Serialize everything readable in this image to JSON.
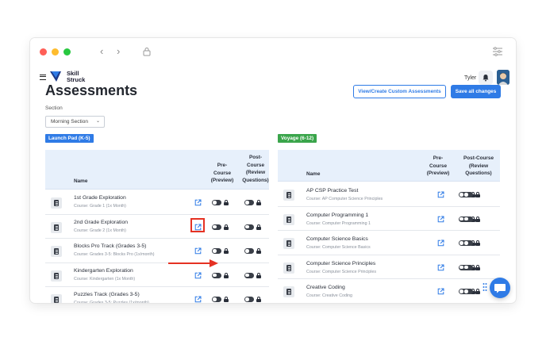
{
  "app": {
    "logo_text_line1": "Skill",
    "logo_text_line2": "Struck",
    "user_name": "Tyler"
  },
  "page": {
    "title": "Assessments",
    "view_create_button": "View/Create Custom Assessments",
    "save_all_button": "Save all changes",
    "section_label": "Section",
    "section_value": "Morning Section"
  },
  "columns": {
    "name": "Name",
    "pre_course_l1": "Pre-",
    "pre_course_l2": "Course",
    "pre_course_l3": "(Preview)",
    "left_post_l1": "Post-",
    "left_post_l2": "Course",
    "left_post_l3": "(Review",
    "left_post_l4": "Questions)",
    "right_post_l1": "Post-Course",
    "right_post_l2": "(Review",
    "right_post_l3": "Questions)"
  },
  "launch_pad": {
    "badge": "Launch Pad (K-5)",
    "rows": [
      {
        "title": "1st Grade Exploration",
        "course": "Course: Grade 1 (1x Month)"
      },
      {
        "title": "2nd Grade Exploration",
        "course": "Course: Grade 2 (1x Month)"
      },
      {
        "title": "Blocks Pro Track (Grades 3-5)",
        "course": "Course: Grades 3-5: Blocks Pro (1x/month)"
      },
      {
        "title": "Kindergarten Exploration",
        "course": "Course: Kindergarten (1x Month)"
      },
      {
        "title": "Puzzles Track (Grades 3-5)",
        "course": "Course: Grades 3-5: Puzzles (1x/month)"
      }
    ]
  },
  "voyage": {
    "badge": "Voyage (6-12)",
    "rows": [
      {
        "title": "AP CSP Practice Test",
        "course": "Course: AP Computer Science Principles"
      },
      {
        "title": "Computer Programming 1",
        "course": "Course: Computer Programming 1"
      },
      {
        "title": "Computer Science Basics",
        "course": "Course: Computer Science Basics"
      },
      {
        "title": "Computer Science Principles",
        "course": "Course: Computer Science Principles"
      },
      {
        "title": "Creative Coding",
        "course": "Course: Creative Coding"
      }
    ]
  },
  "colors": {
    "accent": "#2f7be6",
    "launch_pad": "#2f7be6",
    "voyage": "#3aa54b",
    "annotation": "#e53223"
  }
}
